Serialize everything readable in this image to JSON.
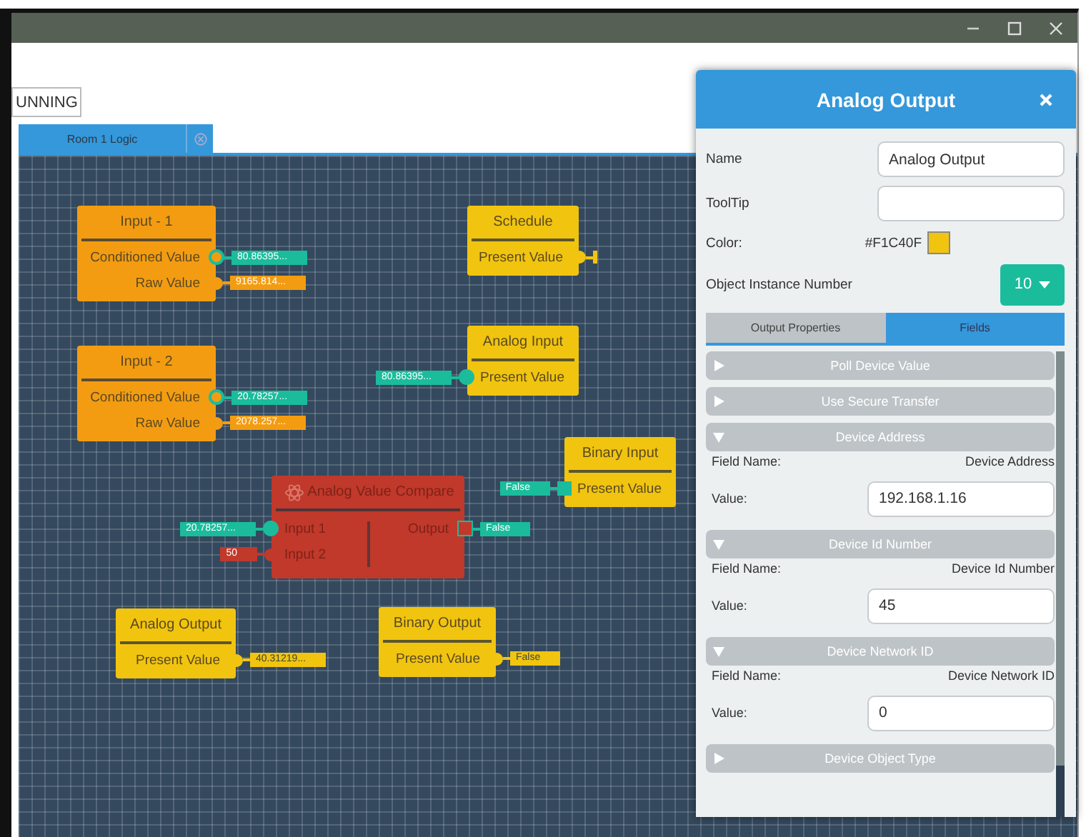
{
  "toolbar": {
    "status_button": "UNNING"
  },
  "tabs": [
    {
      "label": "Room 1 Logic",
      "selected": true
    }
  ],
  "canvas": {
    "nodes": [
      {
        "title": "Input - 1",
        "color": "#f39c12",
        "kind": "object",
        "outputs": [
          {
            "label": "Conditioned Value",
            "kind": "ring",
            "tag": {
              "text": "80.86395...",
              "color": "#1abc9c"
            }
          },
          {
            "label": "Raw Value",
            "kind": "bump",
            "tag": {
              "text": "9165.814...",
              "color": "#f39c12"
            }
          }
        ]
      },
      {
        "title": "Input - 2",
        "color": "#f39c12",
        "kind": "object",
        "outputs": [
          {
            "label": "Conditioned Value",
            "kind": "ring",
            "tag": {
              "text": "20.78257...",
              "color": "#1abc9c"
            }
          },
          {
            "label": "Raw Value",
            "kind": "bump",
            "tag": {
              "text": "2078.257...",
              "color": "#f39c12"
            }
          }
        ]
      },
      {
        "title": "Schedule",
        "color": "#f1c40f",
        "kind": "object",
        "outputs": [
          {
            "label": "Present Value",
            "kind": "bump",
            "stub": true
          }
        ]
      },
      {
        "title": "Analog Input",
        "color": "#f1c40f",
        "kind": "object",
        "inputs": [
          {
            "label": "Present Value",
            "kind": "dot",
            "tag": {
              "text": "80.86395...",
              "color": "#1abc9c"
            }
          }
        ]
      },
      {
        "title": "Binary Input",
        "color": "#f1c40f",
        "kind": "object",
        "inputs": [
          {
            "label": "Present Value",
            "kind": "square",
            "tag": {
              "text": "False",
              "color": "#1abc9c"
            }
          }
        ]
      },
      {
        "title": "Analog Value Compare",
        "color": "#c0392b",
        "kind": "compare",
        "inputs": [
          {
            "label": "Input 1",
            "kind": "dot",
            "tag": {
              "text": "20.78257...",
              "color": "#1abc9c"
            }
          },
          {
            "label": "Input 2",
            "kind": "bump",
            "tag": {
              "text": "50",
              "color": "#c0392b"
            }
          }
        ],
        "outputs": [
          {
            "label": "Output",
            "kind": "square-ring",
            "tag": {
              "text": "False",
              "color": "#1abc9c"
            }
          }
        ]
      },
      {
        "title": "Analog Output",
        "color": "#f1c40f",
        "kind": "object",
        "outputs": [
          {
            "label": "Present Value",
            "kind": "bump",
            "tag": {
              "text": "40.31219...",
              "color": "#f1c40f"
            }
          }
        ]
      },
      {
        "title": "Binary Output",
        "color": "#f1c40f",
        "kind": "object",
        "outputs": [
          {
            "label": "Present Value",
            "kind": "bump",
            "tag": {
              "text": "False",
              "color": "#f1c40f"
            }
          }
        ]
      }
    ]
  },
  "panel": {
    "title": "Analog Output",
    "fields": [
      {
        "label": "Name",
        "kind": "text",
        "value": "Analog Output"
      },
      {
        "label": "ToolTip",
        "kind": "text"
      },
      {
        "label": "Color:",
        "kind": "color",
        "value": "#F1C40F",
        "color": "#f1c40f"
      },
      {
        "label": "Object Instance Number",
        "kind": "dropdown",
        "value": "10"
      }
    ],
    "tabs": [
      {
        "label": "Output Properties",
        "selected": false
      },
      {
        "label": "Fields",
        "selected": true
      }
    ],
    "sections": [
      {
        "title": "Poll Device Value",
        "expanded": false
      },
      {
        "title": "Use Secure Transfer",
        "expanded": false
      },
      {
        "title": "Device Address",
        "expanded": true,
        "field_name_label": "Field Name:",
        "field_name": "Device Address",
        "value_label": "Value:",
        "value": "192.168.1.16"
      },
      {
        "title": "Device Id Number",
        "expanded": true,
        "field_name_label": "Field Name:",
        "field_name": "Device Id Number",
        "value_label": "Value:",
        "value": "45"
      },
      {
        "title": "Device Network ID",
        "expanded": true,
        "field_name_label": "Field Name:",
        "field_name": "Device Network ID",
        "value_label": "Value:",
        "value": "0"
      },
      {
        "title": "Device Object Type",
        "expanded": false
      }
    ]
  }
}
